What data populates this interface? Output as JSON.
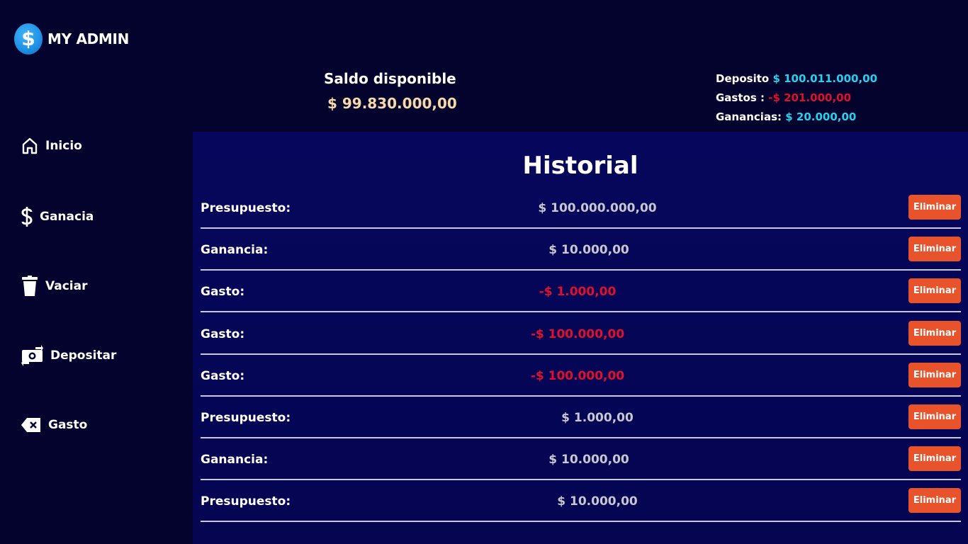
{
  "brand": {
    "title": "MY ADMIN",
    "logo_symbol": "$"
  },
  "nav": [
    {
      "label": "Inicio",
      "icon": "home-icon"
    },
    {
      "label": "Ganacia",
      "icon": "dollar-icon"
    },
    {
      "label": "Vaciar",
      "icon": "trash-icon"
    },
    {
      "label": "Depositar",
      "icon": "money-transfer-icon"
    },
    {
      "label": "Gasto",
      "icon": "backspace-icon"
    }
  ],
  "header": {
    "balance_label": "Saldo disponible",
    "balance_value": "$ 99.830.000,00",
    "summary": {
      "deposito_label": "Deposito",
      "deposito_value": "$ 100.011.000,00",
      "gastos_label": "Gastos :",
      "gastos_value": "-$ 201.000,00",
      "ganancias_label": "Ganancias:",
      "ganancias_value": "$ 20.000,00"
    }
  },
  "main": {
    "title": "Historial",
    "button_label": "Eliminar",
    "rows": [
      {
        "label": "Presupuesto:",
        "amount": "$ 100.000.000,00",
        "negative": false
      },
      {
        "label": "Ganancia:",
        "amount": "$ 10.000,00",
        "negative": false
      },
      {
        "label": "Gasto:",
        "amount": "-$ 1.000,00",
        "negative": true
      },
      {
        "label": "Gasto:",
        "amount": "-$ 100.000,00",
        "negative": true
      },
      {
        "label": "Gasto:",
        "amount": "-$ 100.000,00",
        "negative": true
      },
      {
        "label": "Presupuesto:",
        "amount": "$ 1.000,00",
        "negative": false
      },
      {
        "label": "Ganancia:",
        "amount": "$ 10.000,00",
        "negative": false
      },
      {
        "label": "Presupuesto:",
        "amount": "$ 10.000,00",
        "negative": false
      }
    ]
  },
  "colors": {
    "background": "#03032e",
    "main_background": "#06065c",
    "positive": "#22d3ee",
    "negative": "#e0102a",
    "balance": "#f7d9a8",
    "button": "#e8532b"
  }
}
